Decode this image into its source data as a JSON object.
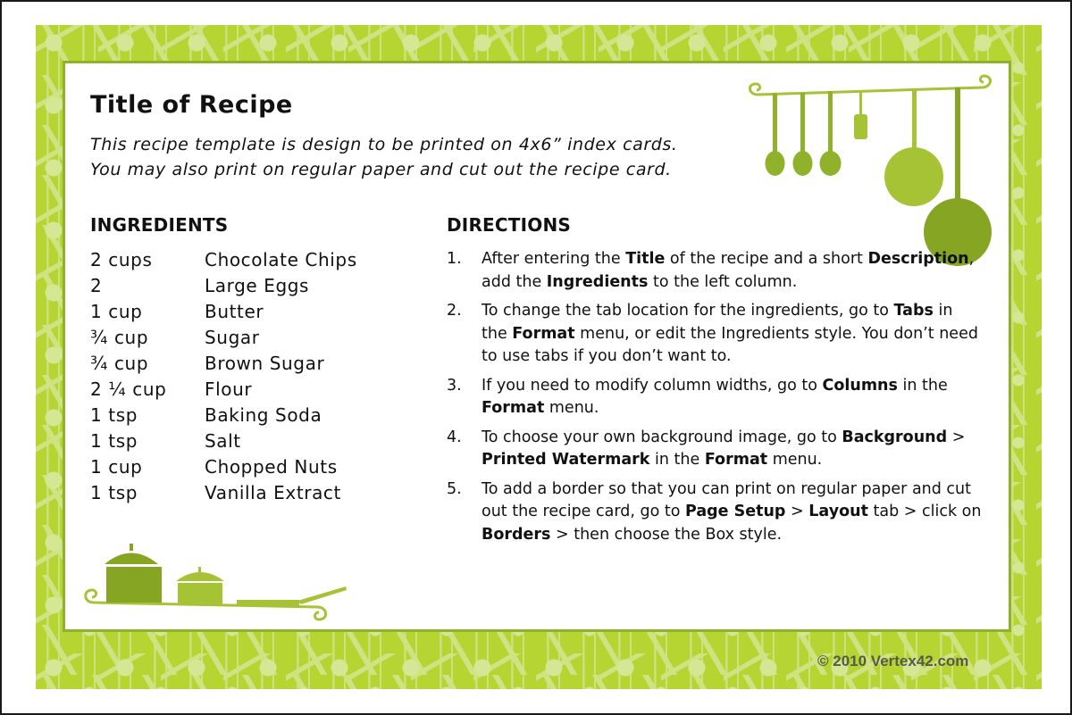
{
  "recipe": {
    "title": "Title of Recipe",
    "description_lines": [
      "This recipe template is design to be printed on 4x6” index cards.",
      "You may also print on regular paper and cut out the recipe card."
    ]
  },
  "ingredients": {
    "heading": "INGREDIENTS",
    "items": [
      {
        "qty": "2 cups",
        "name": "Chocolate Chips"
      },
      {
        "qty": "2",
        "name": "Large Eggs"
      },
      {
        "qty": "1 cup",
        "name": "Butter"
      },
      {
        "qty": "¾ cup",
        "name": "Sugar"
      },
      {
        "qty": "¾ cup",
        "name": "Brown Sugar"
      },
      {
        "qty": "2 ¼ cup",
        "name": "Flour"
      },
      {
        "qty": "1 tsp",
        "name": "Baking Soda"
      },
      {
        "qty": "1 tsp",
        "name": "Salt"
      },
      {
        "qty": "1 cup",
        "name": "Chopped Nuts"
      },
      {
        "qty": "1 tsp",
        "name": "Vanilla Extract"
      }
    ]
  },
  "directions": {
    "heading": "DIRECTIONS",
    "steps": [
      {
        "num": "1.",
        "parts": [
          {
            "t": "After entering the "
          },
          {
            "t": "Title",
            "b": true
          },
          {
            "t": " of the recipe and a short "
          },
          {
            "t": "Description",
            "b": true
          },
          {
            "t": ", add the "
          },
          {
            "t": "Ingredients",
            "b": true
          },
          {
            "t": " to the left column."
          }
        ]
      },
      {
        "num": "2.",
        "parts": [
          {
            "t": "To change the tab location for the ingredients, go to "
          },
          {
            "t": "Tabs",
            "b": true
          },
          {
            "t": " in the "
          },
          {
            "t": "Format",
            "b": true
          },
          {
            "t": " menu, or edit the Ingredients style. You don’t need to use tabs if you don’t want to."
          }
        ]
      },
      {
        "num": "3.",
        "parts": [
          {
            "t": "If you need to modify column widths, go to "
          },
          {
            "t": "Columns",
            "b": true
          },
          {
            "t": " in the "
          },
          {
            "t": "Format",
            "b": true
          },
          {
            "t": " menu."
          }
        ]
      },
      {
        "num": "4.",
        "parts": [
          {
            "t": "To choose your own background image, go to "
          },
          {
            "t": "Background",
            "b": true
          },
          {
            "t": " > "
          },
          {
            "t": "Printed Watermark",
            "b": true
          },
          {
            "t": " in the "
          },
          {
            "t": "Format",
            "b": true
          },
          {
            "t": " menu."
          }
        ]
      },
      {
        "num": "5.",
        "parts": [
          {
            "t": "To add a border so that you can print on regular paper and cut out the recipe card, go to "
          },
          {
            "t": "Page Setup",
            "b": true
          },
          {
            "t": " > "
          },
          {
            "t": "Layout",
            "b": true
          },
          {
            "t": " tab > click on "
          },
          {
            "t": "Borders",
            "b": true
          },
          {
            "t": " > then choose the Box style."
          }
        ]
      }
    ]
  },
  "footer": {
    "copyright": "© 2010 Vertex42.com"
  },
  "colors": {
    "frame_green": "#b6d432",
    "utensil_dark": "#86a623",
    "utensil_light": "#a6c336"
  }
}
